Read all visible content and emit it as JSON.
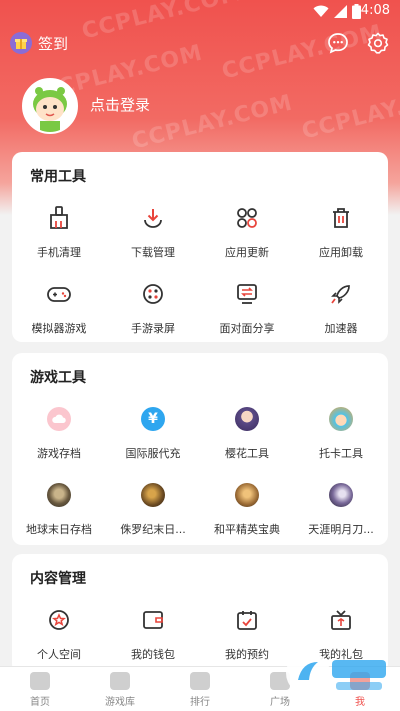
{
  "status": {
    "time": "4:08"
  },
  "header": {
    "signin_label": "签到",
    "login_label": "点击登录",
    "watermark": "CCPLAY.COM"
  },
  "sections": [
    {
      "title": "常用工具",
      "items": [
        {
          "label": "手机清理",
          "icon": "broom-icon"
        },
        {
          "label": "下载管理",
          "icon": "download-icon"
        },
        {
          "label": "应用更新",
          "icon": "apps-grid-icon"
        },
        {
          "label": "应用卸载",
          "icon": "trash-icon"
        },
        {
          "label": "模拟器游戏",
          "icon": "gamepad-icon"
        },
        {
          "label": "手游录屏",
          "icon": "record-icon"
        },
        {
          "label": "面对面分享",
          "icon": "share-screen-icon"
        },
        {
          "label": "加速器",
          "icon": "rocket-icon"
        }
      ]
    },
    {
      "title": "游戏工具",
      "items": [
        {
          "label": "游戏存档",
          "icon": "cloud-save-icon"
        },
        {
          "label": "国际服代充",
          "icon": "yen-icon"
        },
        {
          "label": "樱花工具",
          "icon": "sakura-avatar"
        },
        {
          "label": "托卡工具",
          "icon": "toca-avatar"
        },
        {
          "label": "地球末日存档",
          "icon": "game-avatar"
        },
        {
          "label": "侏罗纪末日...",
          "icon": "game-avatar"
        },
        {
          "label": "和平精英宝典",
          "icon": "game-avatar"
        },
        {
          "label": "天涯明月刀...",
          "icon": "game-avatar"
        }
      ]
    },
    {
      "title": "内容管理",
      "items": [
        {
          "label": "个人空间",
          "icon": "star-badge-icon"
        },
        {
          "label": "我的钱包",
          "icon": "wallet-icon"
        },
        {
          "label": "我的预约",
          "icon": "calendar-check-icon"
        },
        {
          "label": "我的礼包",
          "icon": "gift-box-icon"
        }
      ]
    }
  ],
  "tabs": [
    {
      "label": "首页"
    },
    {
      "label": "游戏库"
    },
    {
      "label": "排行"
    },
    {
      "label": "广场"
    },
    {
      "label": "我"
    }
  ],
  "colors": {
    "accent": "#f0524e",
    "icon": "#e8453c"
  }
}
